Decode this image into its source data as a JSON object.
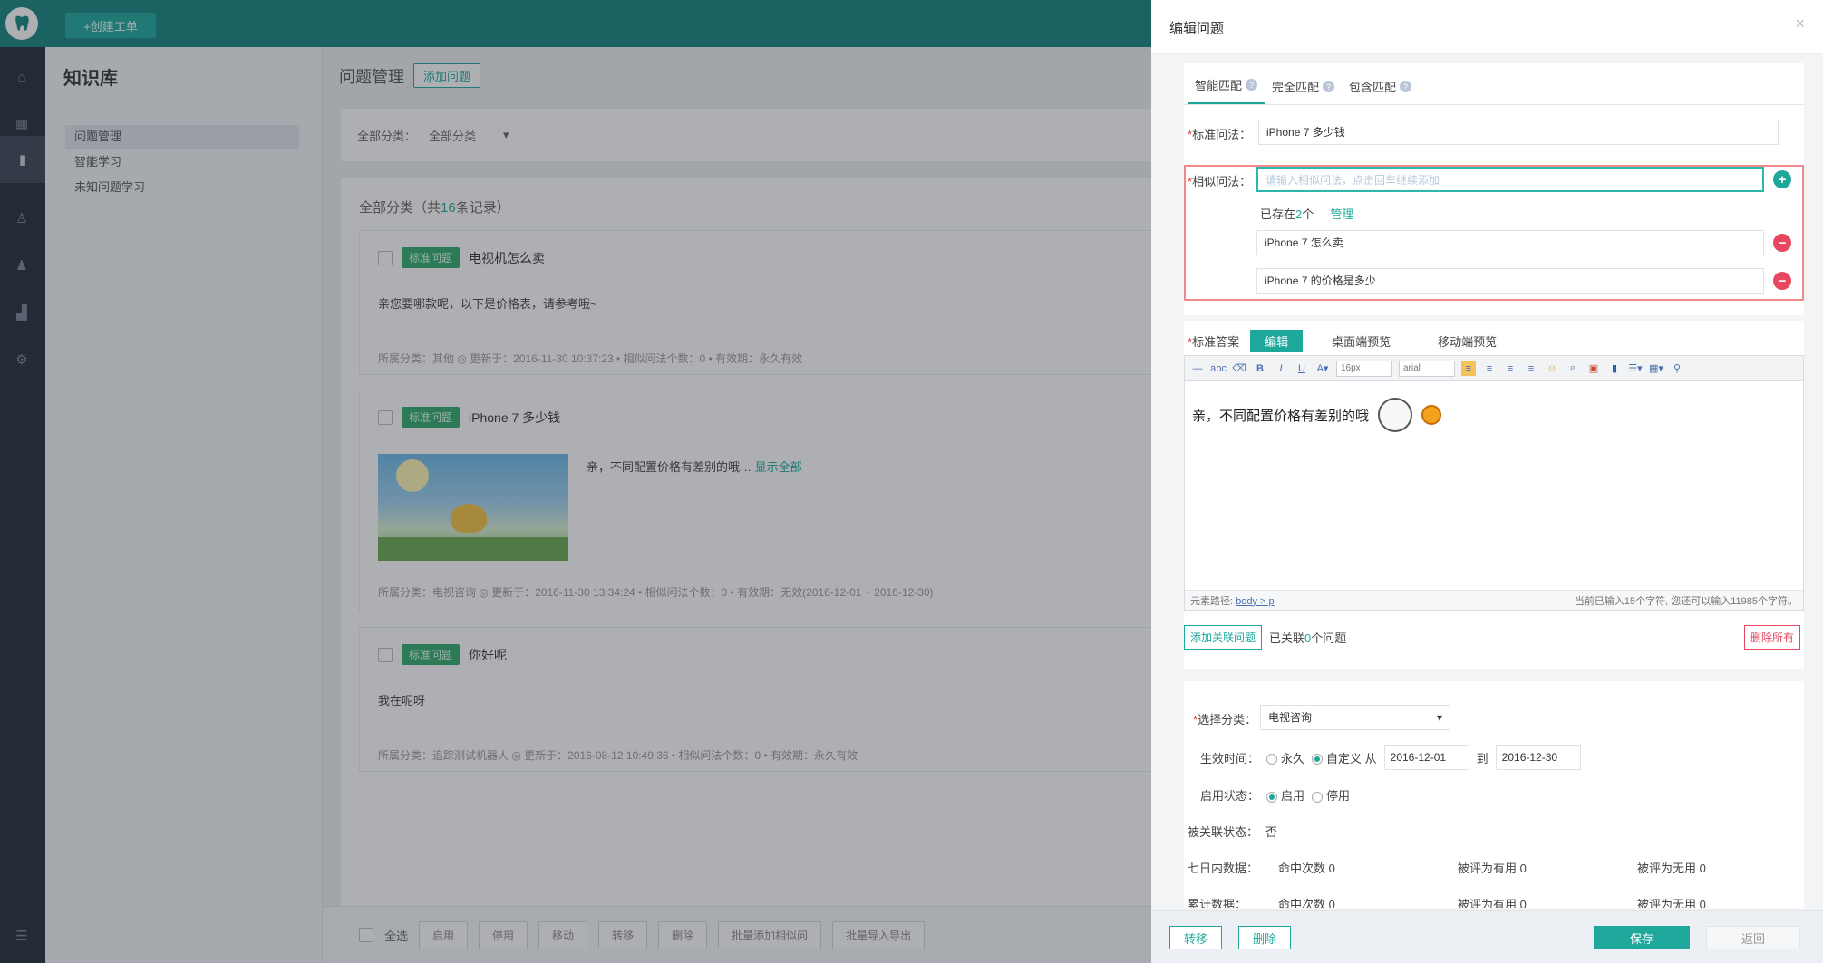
{
  "app": {
    "new_ticket_label": "+创建工单",
    "nav_icons": [
      "home-icon",
      "grid-icon",
      "book-icon",
      "person-icon",
      "group-icon",
      "chart-icon",
      "gear-icon",
      "menu-icon"
    ]
  },
  "subnav": {
    "title": "知识库",
    "items": [
      {
        "label": "问题管理",
        "active": true
      },
      {
        "label": "智能学习",
        "active": false
      },
      {
        "label": "未知问题学习",
        "active": false
      }
    ]
  },
  "main": {
    "title": "问题管理",
    "add_button": "添加问题",
    "filter_label": "全部分类：",
    "filter_value": "全部分类",
    "list_head_prefix": "全部分类（共",
    "list_head_count": "16",
    "list_head_suffix": "条记录）",
    "cards": [
      {
        "tag": "标准问题",
        "title": "电视机怎么卖",
        "body": "亲您要哪款呢，以下是价格表，请参考哦~",
        "meta": "所属分类：其他 ◎ 更新于：2016-11-30 10:37:23 • 相似问法个数：0 • 有效期：永久有效"
      },
      {
        "tag": "标准问题",
        "title": "iPhone 7 多少钱",
        "body": "亲，不同配置价格有差别的哦…",
        "more": "显示全部",
        "meta": "所属分类：电视咨询 ◎ 更新于：2016-11-30 13:34:24 • 相似问法个数：0 • 有效期：无效(2016-12-01 ~ 2016-12-30)"
      },
      {
        "tag": "标准问题",
        "title": "你好呢",
        "body": "我在呢呀",
        "meta": "所属分类：追踪测试机器人 ◎ 更新于：2016-08-12 10:49:36 • 相似问法个数：0 • 有效期：永久有效"
      }
    ],
    "bottom_bar": {
      "select_all": "全选",
      "buttons": [
        "启用",
        "停用",
        "移动",
        "转移",
        "删除",
        "批量添加相似问",
        "批量导入导出"
      ]
    }
  },
  "drawer": {
    "title": "编辑问题",
    "close": "×",
    "tabs": [
      "智能匹配",
      "完全匹配",
      "包含匹配"
    ],
    "standard_label": "标准问法：",
    "standard_value": "iPhone 7 多少钱",
    "similar_label": "相似问法：",
    "similar_placeholder": "请输入相似问法，点击回车继续添加",
    "exists_prefix": "已存在",
    "exists_count": "2",
    "exists_suffix": "个",
    "manage_link": "管理",
    "similar_items": [
      "iPhone 7 怎么卖",
      "iPhone 7 的价格是多少"
    ],
    "answer_label": "标准答案",
    "editor_tabs": [
      "编辑",
      "桌面端预览",
      "移动端预览"
    ],
    "toolbar": {
      "font_size": "16px",
      "font_family": "arial"
    },
    "editor_text": "亲，不同配置价格有差别的哦",
    "status_path_label": "元素路径:",
    "status_path": "body > p",
    "status_count": "当前已输入15个字符, 您还可以输入11985个字符。",
    "add_related_button": "添加关联问题",
    "related_prefix": "已关联",
    "related_count": "0",
    "related_suffix": "个问题",
    "delete_all_button": "删除所有",
    "category_label": "选择分类：",
    "category_value": "电视咨询",
    "effective_label": "生效时间：",
    "effective_permanent": "永久",
    "effective_custom": "自定义 从",
    "date_from": "2016-12-01",
    "date_to_label": "到",
    "date_to": "2016-12-30",
    "enable_label": "启用状态：",
    "enable_on": "启用",
    "enable_off": "停用",
    "linked_label": "被关联状态：",
    "linked_value": "否",
    "stats_label": "七日内数据：",
    "stats": [
      "命中次数 0",
      "被评为有用 0",
      "被评为无用 0"
    ],
    "stats_label2": "累计数据：",
    "stats2": [
      "命中次数 0",
      "被评为有用 0",
      "被评为无用 0"
    ],
    "footer": {
      "move_button": "转移",
      "delete_button": "删除",
      "save_button": "保存",
      "back_button": "返回"
    }
  }
}
